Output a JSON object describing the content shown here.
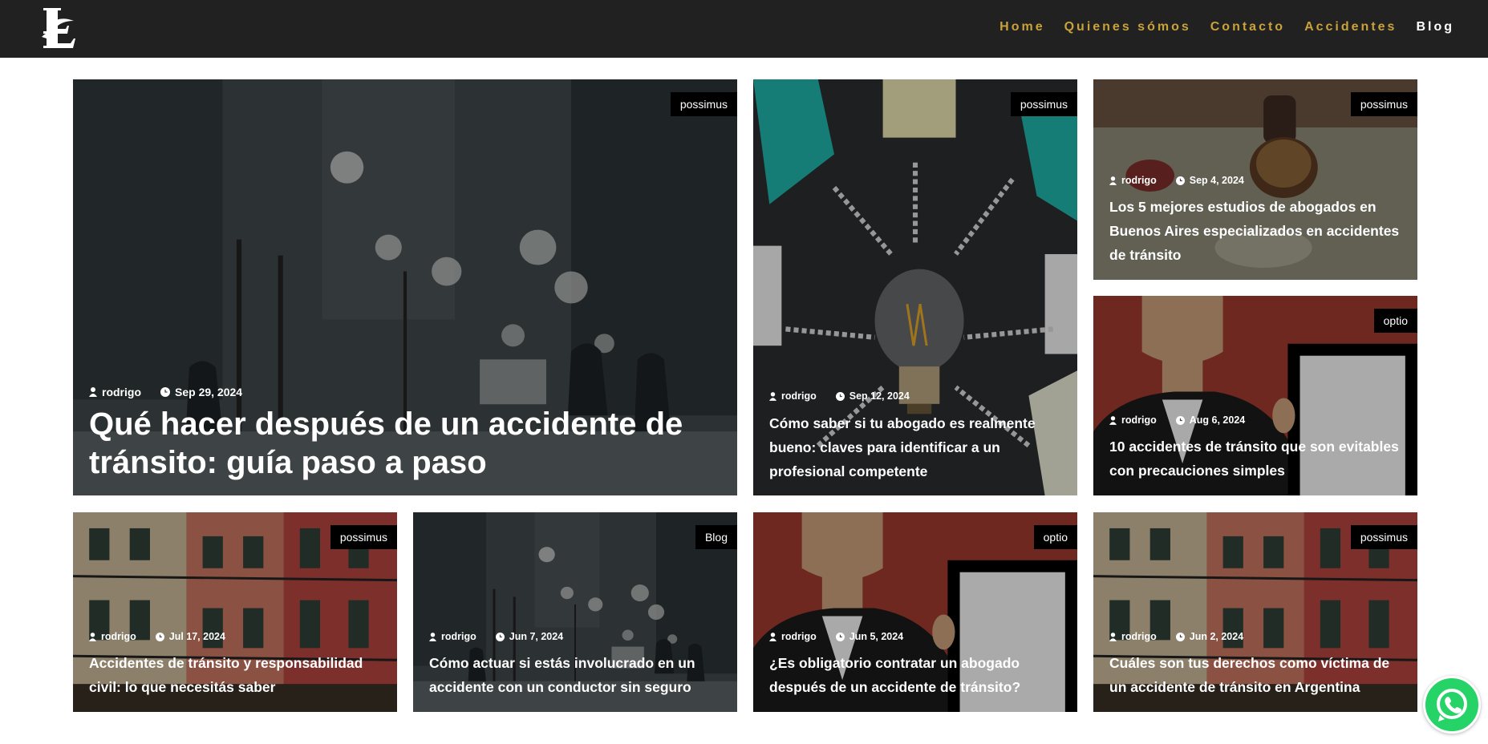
{
  "brand": {
    "logo_text": "LL"
  },
  "nav": {
    "items": [
      {
        "label": "Home",
        "active": false
      },
      {
        "label": "Quienes sómos",
        "active": false
      },
      {
        "label": "Contacto",
        "active": false
      },
      {
        "label": "Accidentes",
        "active": false
      },
      {
        "label": "Blog",
        "active": true
      }
    ]
  },
  "posts": [
    {
      "category": "possimus",
      "author": "rodrigo",
      "date": "Sep 29, 2024",
      "title": "Qué hacer después de un accidente de tránsito: guía paso a paso",
      "image": "snowy-city-street"
    },
    {
      "category": "possimus",
      "author": "rodrigo",
      "date": "Sep 12, 2024",
      "title": "Cómo saber si tu abogado es realmente bueno: claves para identificar a un profesional competente",
      "image": "light-bulb-notes"
    },
    {
      "category": "possimus",
      "author": "rodrigo",
      "date": "Sep 4, 2024",
      "title": "Los 5 mejores estudios de abogados en Buenos Aires especializados en accidentes de tránsito",
      "image": "wax-seal-stamp"
    },
    {
      "category": "optio",
      "author": "rodrigo",
      "date": "Aug 6, 2024",
      "title": "10 accidentes de tránsito que son evitables con precauciones simples",
      "image": "person-holding-frame"
    },
    {
      "category": "possimus",
      "author": "rodrigo",
      "date": "Jul 17, 2024",
      "title": "Accidentes de tránsito y responsabilidad civil: lo que necesitás saber",
      "image": "colorful-buildings"
    },
    {
      "category": "Blog",
      "author": "rodrigo",
      "date": "Jun 7, 2024",
      "title": "Cómo actuar si estás involucrado en un accidente con un conductor sin seguro",
      "image": "snowy-city-street"
    },
    {
      "category": "optio",
      "author": "rodrigo",
      "date": "Jun 5, 2024",
      "title": "¿Es obligatorio contratar un abogado después de un accidente de tránsito?",
      "image": "person-holding-frame"
    },
    {
      "category": "possimus",
      "author": "rodrigo",
      "date": "Jun 2, 2024",
      "title": "Cuáles son tus derechos como víctima de un accidente de tránsito en Argentina",
      "image": "colorful-buildings"
    }
  ],
  "whatsapp": {
    "icon": "whatsapp-icon",
    "color": "#25d366"
  },
  "colors": {
    "nav_text": "#c9a23a",
    "nav_active": "#ffffff",
    "header_bg": "#212121",
    "badge_bg": "#000000"
  }
}
